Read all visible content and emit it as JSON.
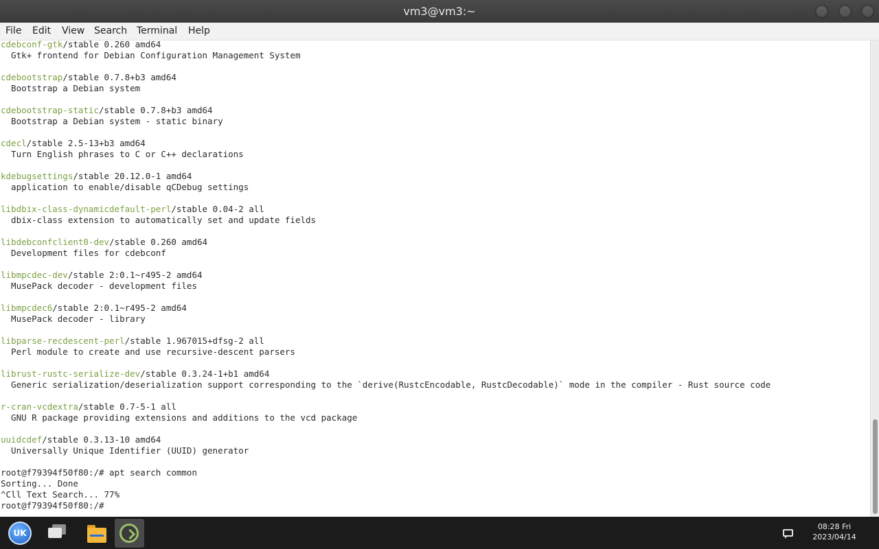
{
  "window": {
    "title": "vm3@vm3:~"
  },
  "menu": [
    "File",
    "Edit",
    "View",
    "Search",
    "Terminal",
    "Help"
  ],
  "terminal": {
    "entries": [
      {
        "name": "cdebconf-gtk",
        "rest": "/stable 0.260 amd64",
        "desc": "  Gtk+ frontend for Debian Configuration Management System"
      },
      {
        "name": "cdebootstrap",
        "rest": "/stable 0.7.8+b3 amd64",
        "desc": "  Bootstrap a Debian system"
      },
      {
        "name": "cdebootstrap-static",
        "rest": "/stable 0.7.8+b3 amd64",
        "desc": "  Bootstrap a Debian system - static binary"
      },
      {
        "name": "cdecl",
        "rest": "/stable 2.5-13+b3 amd64",
        "desc": "  Turn English phrases to C or C++ declarations"
      },
      {
        "name": "kdebugsettings",
        "rest": "/stable 20.12.0-1 amd64",
        "desc": "  application to enable/disable qCDebug settings"
      },
      {
        "name": "libdbix-class-dynamicdefault-perl",
        "rest": "/stable 0.04-2 all",
        "desc": "  dbix-class extension to automatically set and update fields"
      },
      {
        "name": "libdebconfclient0-dev",
        "rest": "/stable 0.260 amd64",
        "desc": "  Development files for cdebconf"
      },
      {
        "name": "libmpcdec-dev",
        "rest": "/stable 2:0.1~r495-2 amd64",
        "desc": "  MusePack decoder - development files"
      },
      {
        "name": "libmpcdec6",
        "rest": "/stable 2:0.1~r495-2 amd64",
        "desc": "  MusePack decoder - library"
      },
      {
        "name": "libparse-recdescent-perl",
        "rest": "/stable 1.967015+dfsg-2 all",
        "desc": "  Perl module to create and use recursive-descent parsers"
      },
      {
        "name": "librust-rustc-serialize-dev",
        "rest": "/stable 0.3.24-1+b1 amd64",
        "desc": "  Generic serialization/deserialization support corresponding to the `derive(RustcEncodable, RustcDecodable)` mode in the compiler - Rust source code"
      },
      {
        "name": "r-cran-vcdextra",
        "rest": "/stable 0.7-5-1 all",
        "desc": "  GNU R package providing extensions and additions to the vcd package"
      },
      {
        "name": "uuidcdef",
        "rest": "/stable 0.3.13-10 amd64",
        "desc": "  Universally Unique Identifier (UUID) generator"
      }
    ],
    "tail": [
      "root@f79394f50f80:/# apt search common",
      "Sorting... Done",
      "^Cll Text Search... 77%",
      "root@f79394f50f80:/#"
    ]
  },
  "taskbar": {
    "start_label": "UK",
    "clock_time": "08:28 Fri",
    "clock_date": "2023/04/14"
  },
  "colors": {
    "package_name": "#7ca043",
    "terminal_text": "#2b2b2b",
    "titlebar": "#3a3a3a",
    "taskbar": "#1b1b1b"
  }
}
